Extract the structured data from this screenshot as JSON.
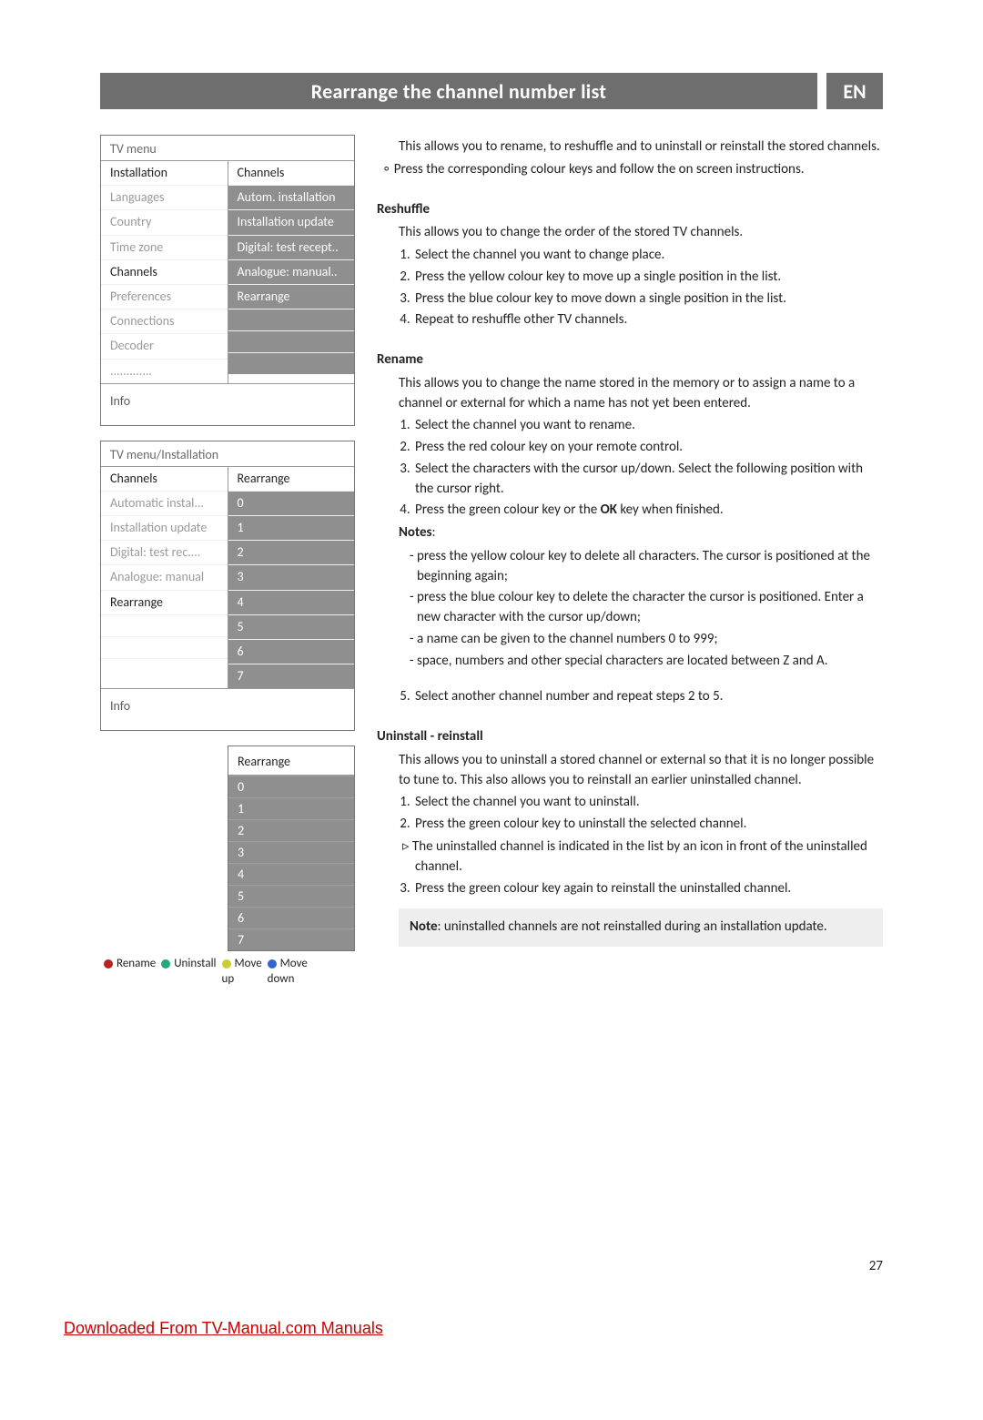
{
  "header": {
    "title": "Rearrange the channel number list",
    "lang": "EN"
  },
  "panel1": {
    "title": "TV menu",
    "left_header": "Installation",
    "left": [
      "Languages",
      "Country",
      "Time zone",
      "Channels",
      "Preferences",
      "Connections",
      "Decoder",
      "............."
    ],
    "right_header": "Channels",
    "right": [
      "Autom. installation",
      "Installation update",
      "Digital: test recept..",
      "Analogue: manual..",
      "Rearrange"
    ],
    "selected_left": "Channels",
    "info": "Info"
  },
  "panel2": {
    "title": "TV menu/Installation",
    "left_header": "Channels",
    "left": [
      "Automatic instal...",
      "Installation update",
      "Digital: test rec....",
      "Analogue: manual",
      "Rearrange"
    ],
    "right_header": "Rearrange",
    "right": [
      "0",
      "1",
      "2",
      "3",
      "4",
      "5",
      "6",
      "7"
    ],
    "selected_left": "Rearrange",
    "info": "Info"
  },
  "panel3": {
    "title": "Rearrange",
    "rows": [
      "0",
      "1",
      "2",
      "3",
      "4",
      "5",
      "6",
      "7"
    ]
  },
  "legend": [
    {
      "color": "red",
      "label": "Rename"
    },
    {
      "color": "green",
      "label": "Uninstall"
    },
    {
      "color": "yellow",
      "label": "Move\nup"
    },
    {
      "color": "blue",
      "label": "Move\ndown"
    }
  ],
  "text": {
    "intro1": "This allows you to rename, to reshuffle and to uninstall or reinstall the stored channels.",
    "intro2": "Press the corresponding colour keys and follow the on screen instructions.",
    "h_reshuffle": "Reshuffle",
    "reshuffle_p": "This allows you to change the order of the stored TV channels.",
    "reshuffle_steps": [
      "Select the channel you want to change place.",
      "Press the yellow colour key  to move up a single position in the list.",
      "Press the blue colour key to move down a single position in the list.",
      "Repeat to reshuffle other TV channels."
    ],
    "h_rename": "Rename",
    "rename_p": "This allows you to change the name stored in the memory or to assign a name to a channel or external for which a name has not yet been entered.",
    "rename_steps": [
      "Select the channel you want to rename.",
      "Press the red colour key on your remote control.",
      "Select the characters with the cursor up/down. Select the following position with the cursor right.",
      "Press the green colour key or the OK key when finished."
    ],
    "notes_label": "Notes",
    "notes": [
      "press the yellow colour key to delete all characters. The cursor is positioned at the beginning again;",
      "press the blue colour key to delete the character the cursor is positioned. Enter a new character with the cursor up/down;",
      "a name can be given to the channel numbers 0 to 999;",
      "space, numbers and other special characters are located between Z and A."
    ],
    "rename_step5": "Select another channel number and repeat steps 2 to 5.",
    "h_uninstall": "Uninstall - reinstall",
    "uninstall_p": "This allows you to uninstall a stored channel or external so that it is no longer possible to tune to. This also allows you to reinstall an earlier uninstalled channel.",
    "uninstall_steps": [
      "Select the channel you want to uninstall.",
      "Press the green colour key to uninstall the selected channel."
    ],
    "uninstall_sub": "The uninstalled channel is indicated in the list by an icon in front of the uninstalled channel.",
    "uninstall_step3": "Press the green colour key again to reinstall the uninstalled channel.",
    "uninstall_note": "Note: uninstalled channels are not reinstalled during an installation update.",
    "note_bold": "Note"
  },
  "page_number": "27",
  "footer": "Downloaded From TV-Manual.com Manuals"
}
